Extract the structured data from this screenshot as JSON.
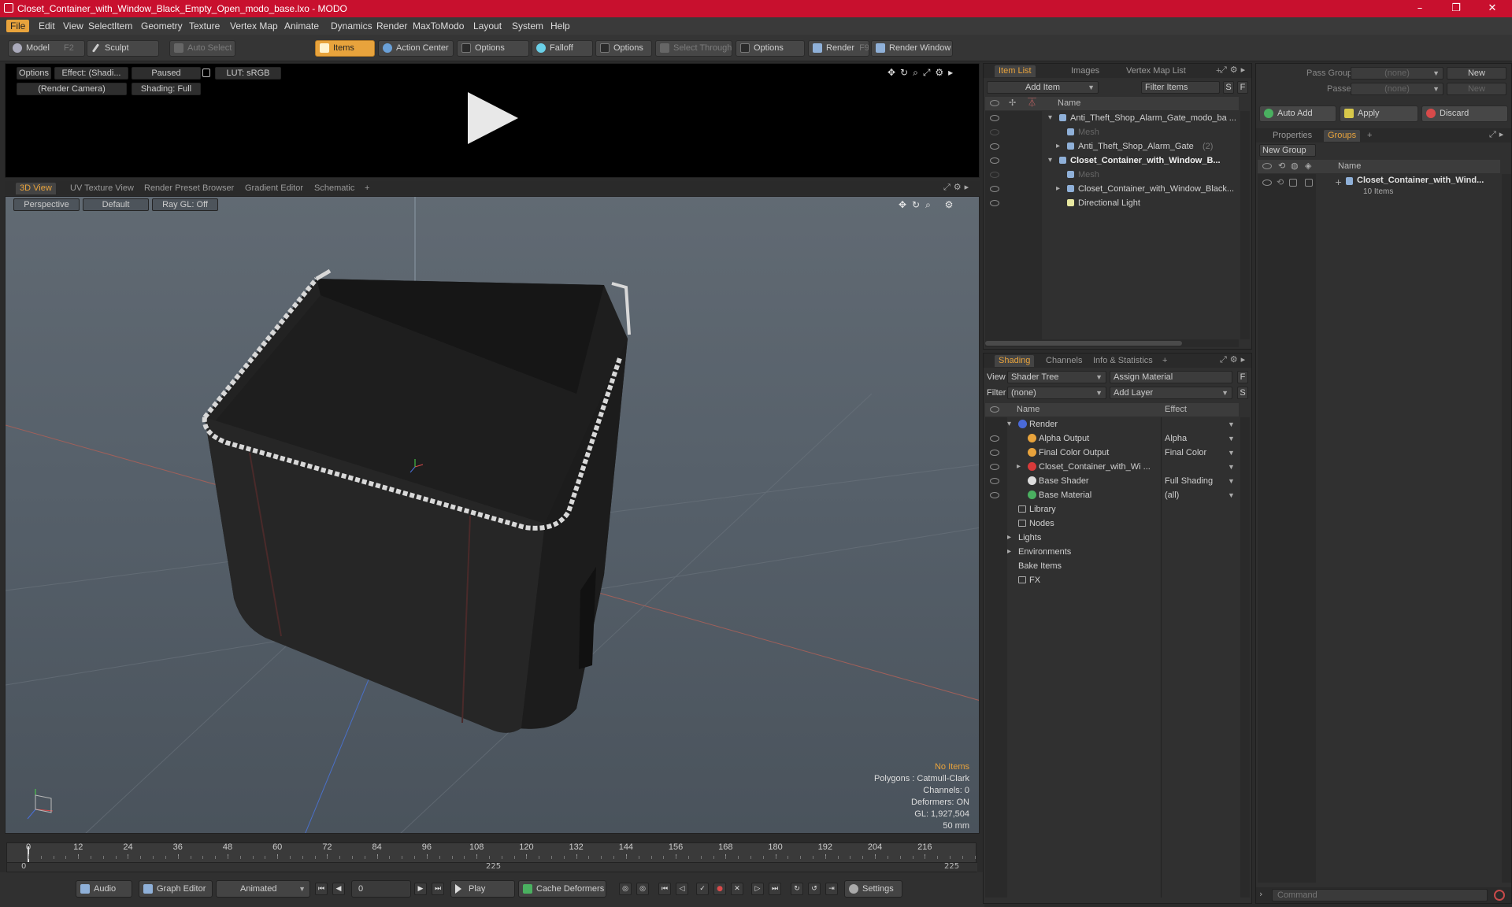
{
  "window": {
    "title": "Closet_Container_with_Window_Black_Empty_Open_modo_base.lxo - MODO",
    "minimize": "–",
    "maximize": "❐",
    "close": "✕"
  },
  "menu": [
    "File",
    "Edit",
    "View",
    "Select",
    "Item",
    "Geometry",
    "Texture",
    "Vertex Map",
    "Animate",
    "Dynamics",
    "Render",
    "MaxToModo",
    "Layout",
    "System",
    "Help"
  ],
  "toolbar": {
    "model": "Model",
    "model_hotkey": "F2",
    "sculpt": "Sculpt",
    "auto_select": "Auto Select",
    "items": "Items",
    "action_center": "Action Center",
    "options1": "Options",
    "falloff": "Falloff",
    "options2": "Options",
    "select_through": "Select Through",
    "options3": "Options",
    "render": "Render",
    "render_hotkey": "F9",
    "render_window": "Render Window"
  },
  "render_preview": {
    "options": "Options",
    "effect": "Effect: (Shadi...",
    "paused": "Paused",
    "lut": "LUT: sRGB",
    "camera": "(Render Camera)",
    "shading": "Shading: Full"
  },
  "viewport_tabs": [
    "3D View",
    "UV Texture View",
    "Render Preset Browser",
    "Gradient Editor",
    "Schematic",
    "+"
  ],
  "viewport": {
    "perspective": "Perspective",
    "default": "Default",
    "raygl": "Ray GL: Off",
    "hud": {
      "no_items": "No Items",
      "polygons": "Polygons : Catmull-Clark",
      "channels": "Channels: 0",
      "deformers": "Deformers: ON",
      "gl": "GL: 1,927,504",
      "focal": "50 mm"
    }
  },
  "timeline": {
    "ticks": [
      "0",
      "12",
      "24",
      "36",
      "48",
      "60",
      "72",
      "84",
      "96",
      "108",
      "120",
      "132",
      "144",
      "156",
      "168",
      "180",
      "192",
      "204",
      "216"
    ],
    "start": "0",
    "mid": "225",
    "end": "225"
  },
  "bottom": {
    "audio": "Audio",
    "graph_editor": "Graph Editor",
    "animated": "Animated",
    "frame": "0",
    "play": "Play",
    "cache_deformers": "Cache Deformers",
    "settings": "Settings"
  },
  "item_list": {
    "tabs": [
      "Item List",
      "Images",
      "Vertex Map List",
      "+"
    ],
    "add_item": "Add Item",
    "filter_items": "Filter Items",
    "s": "S",
    "f": "F",
    "col_name": "Name",
    "rows": [
      {
        "label": "Anti_Theft_Shop_Alarm_Gate_modo_ba ...",
        "indent": 0,
        "bold": false,
        "arrow": "▾"
      },
      {
        "label": "Mesh",
        "indent": 1,
        "dim": true
      },
      {
        "label": "Anti_Theft_Shop_Alarm_Gate",
        "suffix": "(2)",
        "indent": 1,
        "arrow": "▸"
      },
      {
        "label": "Closet_Container_with_Window_B...",
        "indent": 0,
        "bold": true,
        "arrow": "▾"
      },
      {
        "label": "Mesh",
        "indent": 1,
        "dim": true
      },
      {
        "label": "Closet_Container_with_Window_Black...",
        "indent": 1,
        "arrow": "▸"
      },
      {
        "label": "Directional Light",
        "indent": 1
      }
    ]
  },
  "shading": {
    "tabs": [
      "Shading",
      "Channels",
      "Info & Statistics",
      "+"
    ],
    "view_label": "View",
    "view_value": "Shader Tree",
    "assign_material": "Assign Material",
    "filter_label": "Filter",
    "filter_value": "(none)",
    "add_layer": "Add Layer",
    "f": "F",
    "s": "S",
    "col_name": "Name",
    "col_effect": "Effect",
    "rows": [
      {
        "label": "Render",
        "effect": "",
        "indent": 0,
        "arrow": "▾",
        "color": "#4a6ad8"
      },
      {
        "label": "Alpha Output",
        "effect": "Alpha",
        "indent": 1,
        "color": "#e8a33c"
      },
      {
        "label": "Final Color Output",
        "effect": "Final Color",
        "indent": 1,
        "color": "#e8a33c"
      },
      {
        "label": "Closet_Container_with_Wi ...",
        "effect": "",
        "indent": 1,
        "arrow": "▸",
        "color": "#d83a3a"
      },
      {
        "label": "Base Shader",
        "effect": "Full Shading",
        "indent": 1,
        "color": "#dddddd"
      },
      {
        "label": "Base Material",
        "effect": "(all)",
        "indent": 1,
        "color": "#4ab060"
      },
      {
        "label": "Library",
        "indent": 0
      },
      {
        "label": "Nodes",
        "indent": 0
      },
      {
        "label": "Lights",
        "indent": 0,
        "arrow": "▸"
      },
      {
        "label": "Environments",
        "indent": 0,
        "arrow": "▸"
      },
      {
        "label": "Bake Items",
        "indent": 0
      },
      {
        "label": "FX",
        "indent": 0
      }
    ]
  },
  "groups_panel": {
    "pass_groups_label": "Pass Groups",
    "pass_groups_value": "(none)",
    "new1": "New",
    "passes_label": "Passes",
    "passes_value": "(none)",
    "new2": "New",
    "auto_add": "Auto Add",
    "apply": "Apply",
    "discard": "Discard",
    "tabs": [
      "Properties",
      "Groups",
      "+"
    ],
    "new_group": "New Group",
    "col_name": "Name",
    "group_name": "Closet_Container_with_Wind...",
    "group_count": "10 Items"
  },
  "command": {
    "placeholder": "Command"
  }
}
